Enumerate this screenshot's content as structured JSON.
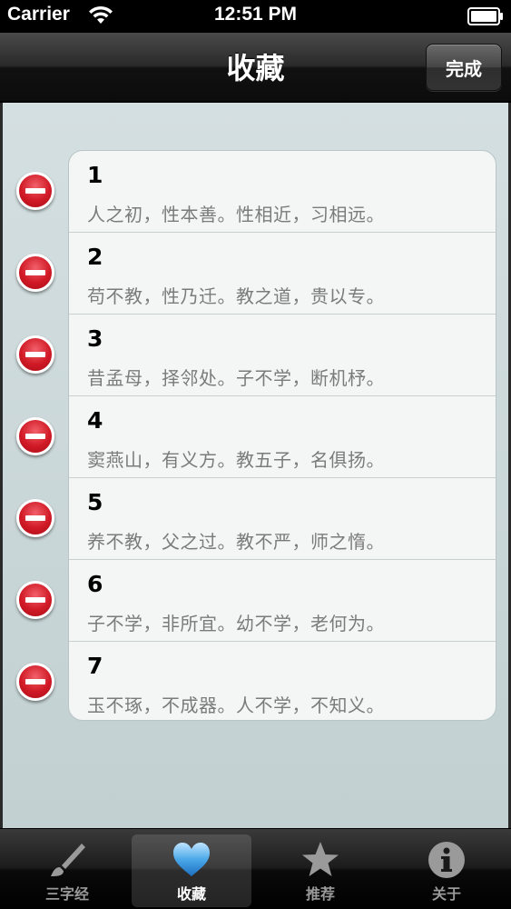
{
  "status_bar": {
    "carrier": "Carrier",
    "time": "12:51 PM"
  },
  "nav": {
    "title": "收藏",
    "done_label": "完成"
  },
  "favorites": [
    {
      "number": "1",
      "verse": "人之初，性本善。性相近，习相远。"
    },
    {
      "number": "2",
      "verse": "苟不教，性乃迁。教之道，贵以专。"
    },
    {
      "number": "3",
      "verse": "昔孟母，择邻处。子不学，断机杼。"
    },
    {
      "number": "4",
      "verse": "窦燕山，有义方。教五子，名俱扬。"
    },
    {
      "number": "5",
      "verse": "养不教，父之过。教不严，师之惰。"
    },
    {
      "number": "6",
      "verse": "子不学，非所宜。幼不学，老何为。"
    },
    {
      "number": "7",
      "verse": "玉不琢，不成器。人不学，不知义。"
    }
  ],
  "tabs": [
    {
      "label": "三字经",
      "icon": "brush-icon",
      "active": false
    },
    {
      "label": "收藏",
      "icon": "heart-icon",
      "active": true
    },
    {
      "label": "推荐",
      "icon": "star-icon",
      "active": false
    },
    {
      "label": "关于",
      "icon": "info-icon",
      "active": false
    }
  ],
  "colors": {
    "delete_red": "#d01a26",
    "heart_blue": "#4aa8e8",
    "content_bg": "#c4d2d4"
  }
}
